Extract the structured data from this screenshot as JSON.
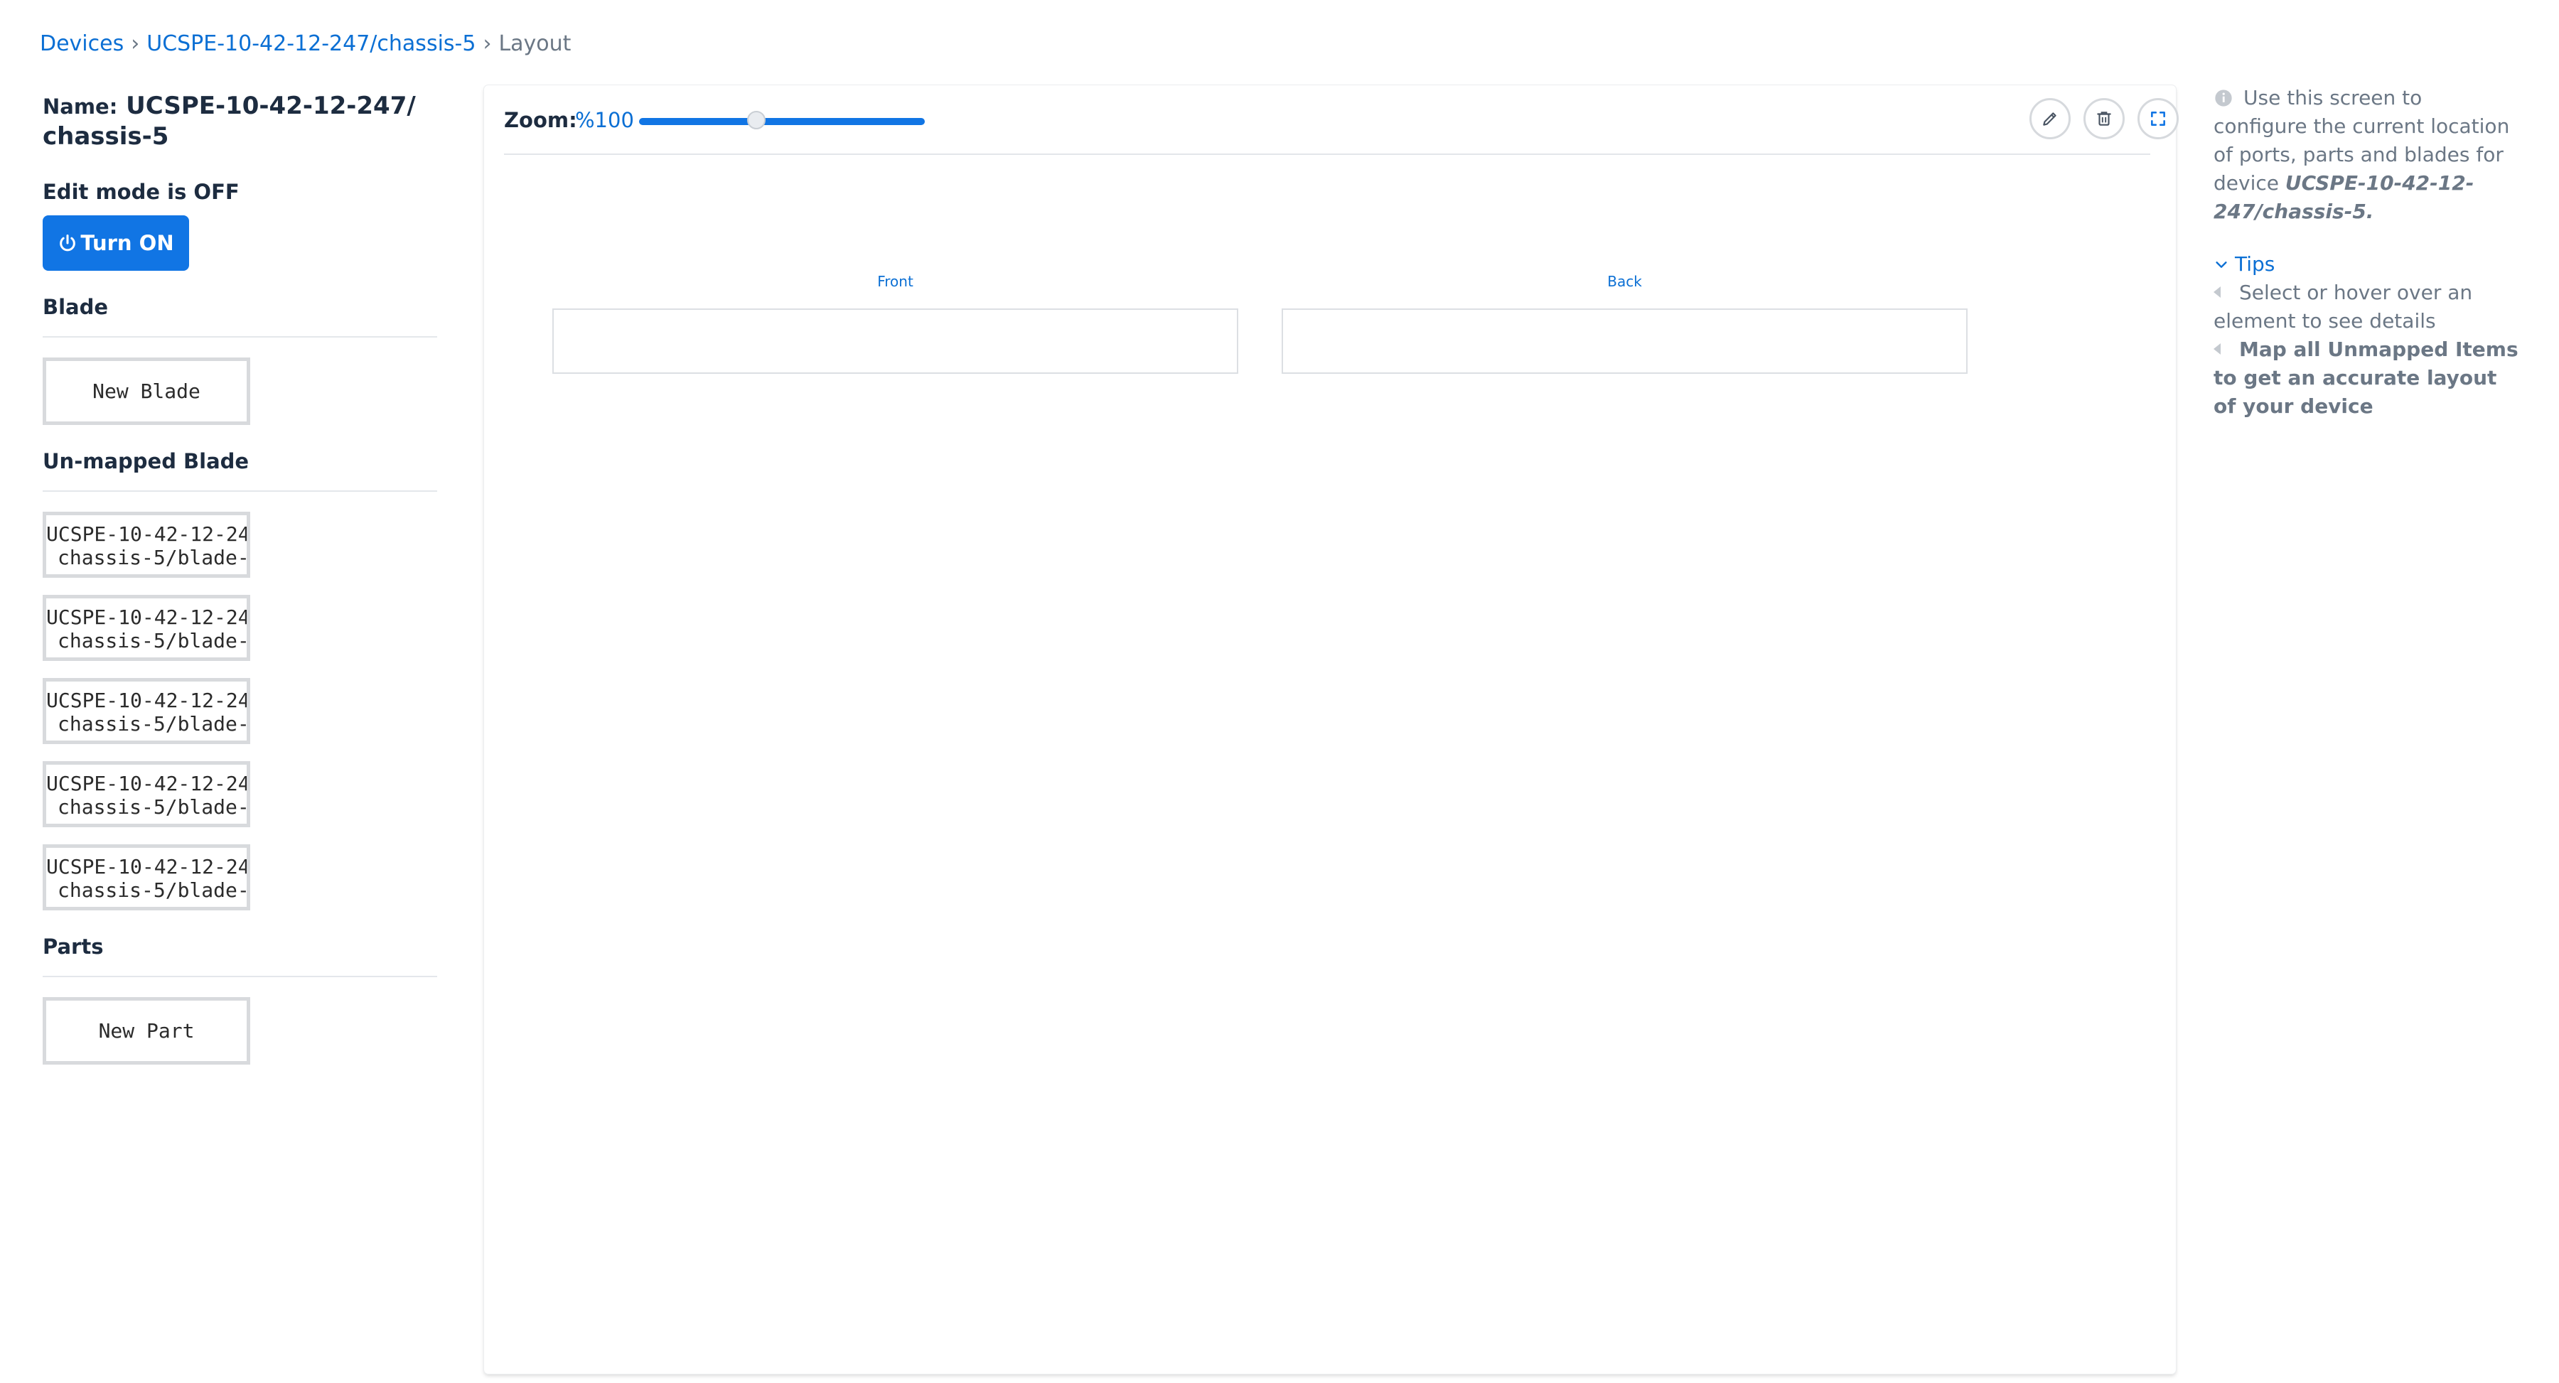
{
  "breadcrumb": {
    "devices": "Devices",
    "separator": "›",
    "device": "UCSPE-10-42-12-247/chassis-5",
    "current": "Layout"
  },
  "left": {
    "name_label": "Name:",
    "name_line1": "UCSPE-10-42-12-247/",
    "name_line2": "chassis-5",
    "edit_mode": "Edit mode is OFF",
    "turn_on": "Turn ON",
    "blade_title": "Blade",
    "new_blade": "New Blade",
    "unmapped_title": "Un-mapped Blade",
    "unmapped": [
      {
        "line1": "UCSPE-10-42-12-24",
        "line2": "chassis-5/blade-"
      },
      {
        "line1": "UCSPE-10-42-12-24",
        "line2": "chassis-5/blade-"
      },
      {
        "line1": "UCSPE-10-42-12-24",
        "line2": "chassis-5/blade-"
      },
      {
        "line1": "UCSPE-10-42-12-24",
        "line2": "chassis-5/blade-"
      },
      {
        "line1": "UCSPE-10-42-12-24",
        "line2": "chassis-5/blade-"
      }
    ],
    "parts_title": "Parts",
    "new_part": "New Part"
  },
  "toolbar": {
    "zoom_label": "Zoom:",
    "zoom_value": "%100",
    "zoom_level_fraction": 0.41
  },
  "canvas": {
    "front_label": "Front",
    "back_label": "Back"
  },
  "help": {
    "intro": "Use this screen to configure the current location of ports, parts and blades for device",
    "device": "UCSPE-10-42-12-247/chassis-5.",
    "tips_title": "Tips",
    "tip1": "Select or hover over an element to see details",
    "tip2": "Map all Unmapped Items to get an accurate layout of your device"
  },
  "colors": {
    "accent": "#1175e4",
    "link": "#0b6fd4",
    "muted": "#6b7785"
  }
}
